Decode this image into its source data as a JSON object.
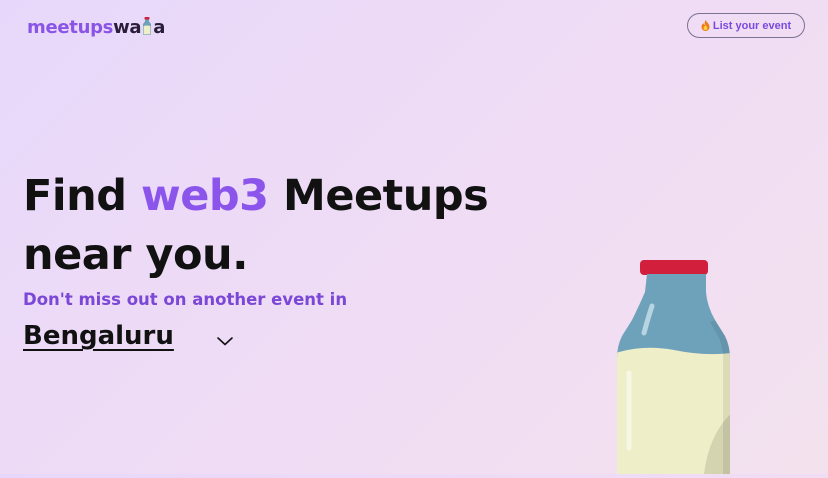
{
  "header": {
    "logo_part1": "meetups",
    "logo_part2a": "wa",
    "logo_part2b": "a",
    "list_event_label": "List your event"
  },
  "hero": {
    "title_prefix": "Find ",
    "title_accent": "web3",
    "title_suffix": " Meetups",
    "title_line2": "near you.",
    "subtitle": "Don't miss out on another event in",
    "selected_city": "Bengaluru"
  },
  "icons": {
    "logo_icon": "milk-bottle-icon",
    "list_event_icon": "fire-icon",
    "city_dropdown_icon": "chevron-down-icon",
    "illustration": "milk-bottle-illustration"
  },
  "colors": {
    "accent": "#8b55ec",
    "subtitle": "#7b47d6",
    "text": "#111111",
    "bottle_cap": "#d21f3c",
    "bottle_glass": "#6ea2bb",
    "milk": "#eeeec8"
  }
}
